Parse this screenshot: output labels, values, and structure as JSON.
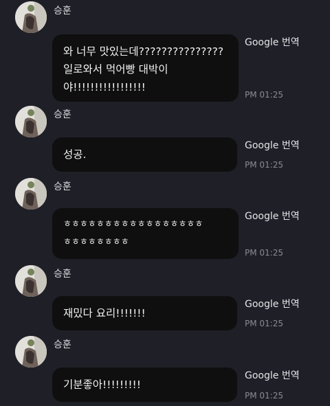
{
  "messages": [
    {
      "sender": "승훈",
      "text": "와 너무 맛있는데???????????????\n일로와서 먹어빵 대박이\n야!!!!!!!!!!!!!!!!!",
      "translate_label": "Google 번역",
      "time": "PM 01:25"
    },
    {
      "sender": "승훈",
      "text": "성공.",
      "translate_label": "Google 번역",
      "time": "PM 01:25"
    },
    {
      "sender": "승훈",
      "text": "ㅎㅎㅎㅎㅎㅎㅎㅎㅎㅎㅎㅎㅎㅎㅎㅎㅎ\nㅎㅎㅎㅎㅎㅎㅎㅎ",
      "translate_label": "Google 번역",
      "time": "PM 01:25"
    },
    {
      "sender": "승훈",
      "text": "재밌다 요리!!!!!!!",
      "translate_label": "Google 번역",
      "time": "PM 01:25"
    },
    {
      "sender": "승훈",
      "text": "기분좋아!!!!!!!!!",
      "translate_label": "Google 번역",
      "time": "PM 01:25"
    }
  ],
  "icons": {
    "avatar": "profile-photo-avatar"
  }
}
